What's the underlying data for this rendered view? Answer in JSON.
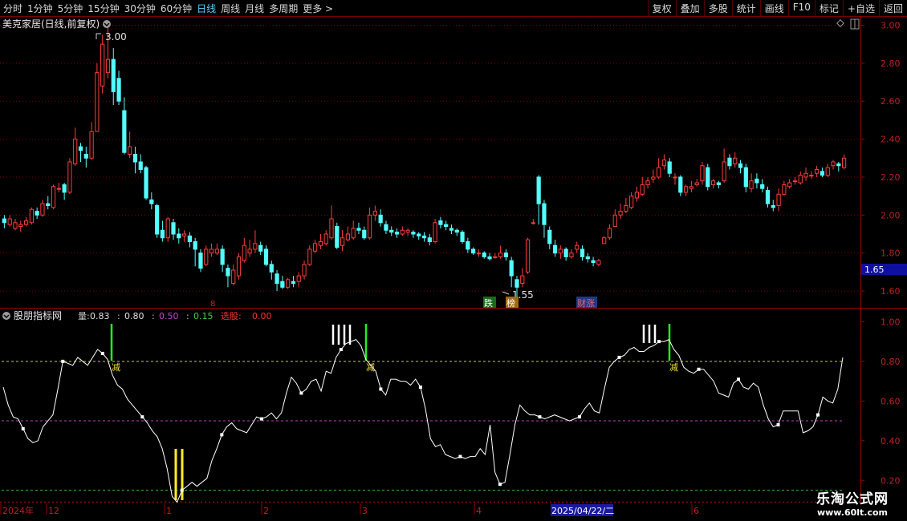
{
  "toolbar": {
    "periods": [
      "分时",
      "1分钟",
      "5分钟",
      "15分钟",
      "30分钟",
      "60分钟",
      "日线",
      "周线",
      "月线",
      "多周期",
      "更多 >"
    ],
    "active_period": "日线",
    "actions": [
      "复权",
      "叠加",
      "多股",
      "统计",
      "画线",
      "F10",
      "标记",
      "+自选",
      "返回"
    ]
  },
  "main_panel": {
    "title": "美克家居(日线,前复权)",
    "high_label": "3.00",
    "low_label": "1.55",
    "current_price_label": "1.65",
    "price_axis": [
      "3.00",
      "2.80",
      "2.60",
      "2.40",
      "2.20",
      "2.00",
      "1.80",
      "1.60"
    ],
    "price_range": [
      1.52,
      3.04
    ],
    "event_markers": [
      "跌",
      "榜",
      "财涨"
    ],
    "small_marker": "8"
  },
  "indicator_panel": {
    "name": "股朋指标网",
    "items": [
      {
        "label": "量:",
        "value": "0.83",
        "color": "#e0e0e0"
      },
      {
        "label": ":",
        "value": "0.80",
        "color": "#e0e0e0"
      },
      {
        "label": ":",
        "value": "0.50",
        "color": "#d040d0"
      },
      {
        "label": ":",
        "value": "0.15",
        "color": "#40d040"
      },
      {
        "label": "选股:",
        "value": "0.00",
        "color": "#ff3030"
      }
    ],
    "axis": [
      "1.00",
      "0.80",
      "0.60",
      "0.40",
      "0.20"
    ],
    "range": [
      0.1,
      1.05
    ],
    "level_lines": [
      {
        "value": 0.8,
        "color": "#d0d040"
      },
      {
        "value": 0.5,
        "color": "#c040c0"
      },
      {
        "value": 0.15,
        "color": "#40c040"
      }
    ],
    "reduce_label": "减"
  },
  "date_axis": {
    "labels": [
      "2024年",
      "12",
      "1",
      "2",
      "3",
      "4",
      "2025/04/22/二",
      "6"
    ]
  },
  "watermark": {
    "line1": "乐淘公式网",
    "line2": "www.60lt.com"
  },
  "chart_data": {
    "type": "candlestick",
    "title": "美克家居(日线,前复权)",
    "candles": [
      [
        1.98,
        1.96,
        2.0,
        1.93
      ],
      [
        1.95,
        1.98,
        2.0,
        1.94
      ],
      [
        1.93,
        1.96,
        1.98,
        1.92
      ],
      [
        1.94,
        1.95,
        1.97,
        1.91
      ],
      [
        1.95,
        1.97,
        1.99,
        1.94
      ],
      [
        1.96,
        2.03,
        2.04,
        1.95
      ],
      [
        2.02,
        2.0,
        2.04,
        1.98
      ],
      [
        2.0,
        2.06,
        2.08,
        1.99
      ],
      [
        2.06,
        2.05,
        2.1,
        2.03
      ],
      [
        2.04,
        2.15,
        2.16,
        2.03
      ],
      [
        2.14,
        2.14,
        2.17,
        2.12
      ],
      [
        2.16,
        2.12,
        2.17,
        2.08
      ],
      [
        2.12,
        2.28,
        2.3,
        2.11
      ],
      [
        2.27,
        2.4,
        2.46,
        2.26
      ],
      [
        2.36,
        2.34,
        2.38,
        2.28
      ],
      [
        2.32,
        2.3,
        2.36,
        2.25
      ],
      [
        2.3,
        2.44,
        2.49,
        2.29
      ],
      [
        2.44,
        2.75,
        2.8,
        2.52
      ],
      [
        2.68,
        2.9,
        2.95,
        2.64
      ],
      [
        2.75,
        2.82,
        3.0,
        2.72
      ],
      [
        2.82,
        2.65,
        2.88,
        2.58
      ],
      [
        2.72,
        2.6,
        2.76,
        2.58
      ],
      [
        2.55,
        2.33,
        2.62,
        2.32
      ],
      [
        2.32,
        2.36,
        2.44,
        2.3
      ],
      [
        2.32,
        2.28,
        2.36,
        2.22
      ],
      [
        2.28,
        2.24,
        2.32,
        2.22
      ],
      [
        2.25,
        2.09,
        2.26,
        2.08
      ],
      [
        2.08,
        2.06,
        2.12,
        2.03
      ],
      [
        2.05,
        1.9,
        2.06,
        1.88
      ],
      [
        1.92,
        1.88,
        1.97,
        1.86
      ],
      [
        1.88,
        1.98,
        1.99,
        1.86
      ],
      [
        1.96,
        1.9,
        1.98,
        1.87
      ],
      [
        1.9,
        1.88,
        1.93,
        1.85
      ],
      [
        1.89,
        1.9,
        1.92,
        1.86
      ],
      [
        1.89,
        1.86,
        1.91,
        1.83
      ],
      [
        1.86,
        1.82,
        1.88,
        1.73
      ],
      [
        1.8,
        1.72,
        1.82,
        1.7
      ],
      [
        1.74,
        1.82,
        1.84,
        1.73
      ],
      [
        1.8,
        1.82,
        1.85,
        1.78
      ],
      [
        1.8,
        1.82,
        1.85,
        1.79
      ],
      [
        1.82,
        1.74,
        1.84,
        1.7
      ],
      [
        1.72,
        1.68,
        1.74,
        1.62
      ],
      [
        1.64,
        1.71,
        1.74,
        1.63
      ],
      [
        1.68,
        1.78,
        1.8,
        1.66
      ],
      [
        1.76,
        1.84,
        1.88,
        1.75
      ],
      [
        1.8,
        1.82,
        1.87,
        1.78
      ],
      [
        1.82,
        1.85,
        1.92,
        1.8
      ],
      [
        1.84,
        1.81,
        1.86,
        1.79
      ],
      [
        1.82,
        1.74,
        1.84,
        1.73
      ],
      [
        1.74,
        1.7,
        1.76,
        1.66
      ],
      [
        1.69,
        1.64,
        1.71,
        1.6
      ],
      [
        1.65,
        1.62,
        1.68,
        1.61
      ],
      [
        1.62,
        1.66,
        1.67,
        1.61
      ],
      [
        1.65,
        1.64,
        1.68,
        1.62
      ],
      [
        1.65,
        1.68,
        1.7,
        1.62
      ],
      [
        1.68,
        1.74,
        1.76,
        1.66
      ],
      [
        1.74,
        1.82,
        1.84,
        1.73
      ],
      [
        1.81,
        1.85,
        1.87,
        1.8
      ],
      [
        1.84,
        1.86,
        1.9,
        1.82
      ],
      [
        1.85,
        1.9,
        1.92,
        1.84
      ],
      [
        1.88,
        1.98,
        2.05,
        1.87
      ],
      [
        1.94,
        1.83,
        1.96,
        1.82
      ],
      [
        1.84,
        1.88,
        1.92,
        1.81
      ],
      [
        1.87,
        1.9,
        1.94,
        1.86
      ],
      [
        1.88,
        1.93,
        1.97,
        1.87
      ],
      [
        1.93,
        1.92,
        1.96,
        1.9
      ],
      [
        1.92,
        1.88,
        1.94,
        1.87
      ],
      [
        1.88,
        2.0,
        2.04,
        1.87
      ],
      [
        2.0,
        2.02,
        2.05,
        1.97
      ],
      [
        2.0,
        1.96,
        2.03,
        1.94
      ],
      [
        1.95,
        1.92,
        1.97,
        1.9
      ],
      [
        1.92,
        1.91,
        1.94,
        1.89
      ],
      [
        1.91,
        1.9,
        1.93,
        1.88
      ],
      [
        1.9,
        1.92,
        1.94,
        1.89
      ],
      [
        1.91,
        1.92,
        1.93,
        1.89
      ],
      [
        1.91,
        1.9,
        1.92,
        1.88
      ],
      [
        1.9,
        1.89,
        1.91,
        1.87
      ],
      [
        1.89,
        1.88,
        1.91,
        1.86
      ],
      [
        1.88,
        1.86,
        1.9,
        1.84
      ],
      [
        1.86,
        1.96,
        1.98,
        1.85
      ],
      [
        1.97,
        1.95,
        1.99,
        1.93
      ],
      [
        1.95,
        1.94,
        1.97,
        1.92
      ],
      [
        1.93,
        1.92,
        1.95,
        1.9
      ],
      [
        1.92,
        1.91,
        1.93,
        1.89
      ],
      [
        1.91,
        1.86,
        1.92,
        1.85
      ],
      [
        1.86,
        1.82,
        1.88,
        1.8
      ],
      [
        1.82,
        1.8,
        1.83,
        1.79
      ],
      [
        1.8,
        1.8,
        1.82,
        1.78
      ],
      [
        1.8,
        1.78,
        1.81,
        1.77
      ],
      [
        1.78,
        1.77,
        1.8,
        1.76
      ],
      [
        1.78,
        1.78,
        1.8,
        1.77
      ],
      [
        1.78,
        1.8,
        1.84,
        1.77
      ],
      [
        1.8,
        1.78,
        1.82,
        1.76
      ],
      [
        1.76,
        1.68,
        1.78,
        1.62
      ],
      [
        1.66,
        1.62,
        1.68,
        1.55
      ],
      [
        1.64,
        1.68,
        1.72,
        1.62
      ],
      [
        1.7,
        1.87,
        1.88,
        1.69
      ],
      [
        1.96,
        1.96,
        1.98,
        1.95
      ],
      [
        2.2,
        2.06,
        2.21,
        1.95
      ],
      [
        2.06,
        1.95,
        2.08,
        1.88
      ],
      [
        1.92,
        1.85,
        1.94,
        1.82
      ],
      [
        1.84,
        1.8,
        1.87,
        1.78
      ],
      [
        1.8,
        1.82,
        1.84,
        1.77
      ],
      [
        1.82,
        1.78,
        1.83,
        1.76
      ],
      [
        1.78,
        1.8,
        1.82,
        1.77
      ],
      [
        1.82,
        1.84,
        1.86,
        1.8
      ],
      [
        1.82,
        1.78,
        1.84,
        1.76
      ],
      [
        1.78,
        1.77,
        1.8,
        1.75
      ],
      [
        1.76,
        1.75,
        1.78,
        1.73
      ],
      [
        1.74,
        1.76,
        1.77,
        1.73
      ],
      [
        1.85,
        1.88,
        1.89,
        1.85
      ],
      [
        1.88,
        1.93,
        1.95,
        1.87
      ],
      [
        1.94,
        2.0,
        2.03,
        1.94
      ],
      [
        2.0,
        2.02,
        2.06,
        1.98
      ],
      [
        2.02,
        2.05,
        2.09,
        2.01
      ],
      [
        2.04,
        2.1,
        2.12,
        2.03
      ],
      [
        2.09,
        2.12,
        2.15,
        2.07
      ],
      [
        2.11,
        2.16,
        2.2,
        2.1
      ],
      [
        2.16,
        2.18,
        2.2,
        2.14
      ],
      [
        2.19,
        2.2,
        2.24,
        2.17
      ],
      [
        2.2,
        2.25,
        2.3,
        2.19
      ],
      [
        2.26,
        2.29,
        2.32,
        2.24
      ],
      [
        2.28,
        2.22,
        2.3,
        2.2
      ],
      [
        2.2,
        2.2,
        2.22,
        2.16
      ],
      [
        2.2,
        2.12,
        2.21,
        2.1
      ],
      [
        2.12,
        2.15,
        2.16,
        2.1
      ],
      [
        2.14,
        2.15,
        2.18,
        2.12
      ],
      [
        2.16,
        2.17,
        2.19,
        2.15
      ],
      [
        2.18,
        2.26,
        2.28,
        2.16
      ],
      [
        2.25,
        2.15,
        2.27,
        2.13
      ],
      [
        2.16,
        2.18,
        2.19,
        2.14
      ],
      [
        2.17,
        2.16,
        2.18,
        2.14
      ],
      [
        2.18,
        2.28,
        2.35,
        2.17
      ],
      [
        2.3,
        2.26,
        2.32,
        2.24
      ],
      [
        2.27,
        2.3,
        2.33,
        2.25
      ],
      [
        2.27,
        2.25,
        2.29,
        2.22
      ],
      [
        2.25,
        2.15,
        2.27,
        2.12
      ],
      [
        2.14,
        2.18,
        2.22,
        2.12
      ],
      [
        2.19,
        2.17,
        2.22,
        2.14
      ],
      [
        2.16,
        2.14,
        2.19,
        2.12
      ],
      [
        2.13,
        2.06,
        2.15,
        2.04
      ],
      [
        2.05,
        2.04,
        2.08,
        2.02
      ],
      [
        2.05,
        2.11,
        2.14,
        2.02
      ],
      [
        2.11,
        2.16,
        2.18,
        2.1
      ],
      [
        2.15,
        2.17,
        2.19,
        2.14
      ],
      [
        2.18,
        2.18,
        2.2,
        2.16
      ],
      [
        2.17,
        2.21,
        2.23,
        2.16
      ],
      [
        2.2,
        2.22,
        2.25,
        2.18
      ],
      [
        2.21,
        2.21,
        2.23,
        2.19
      ],
      [
        2.22,
        2.24,
        2.26,
        2.2
      ],
      [
        2.23,
        2.21,
        2.25,
        2.2
      ],
      [
        2.21,
        2.25,
        2.27,
        2.2
      ],
      [
        2.26,
        2.28,
        2.29,
        2.24
      ],
      [
        2.27,
        2.26,
        2.28,
        2.23
      ],
      [
        2.25,
        2.3,
        2.32,
        2.24
      ]
    ],
    "indicator_line": [
      0.67,
      0.58,
      0.52,
      0.51,
      0.46,
      0.41,
      0.39,
      0.4,
      0.47,
      0.5,
      0.53,
      0.66,
      0.8,
      0.79,
      0.78,
      0.82,
      0.8,
      0.78,
      0.82,
      0.86,
      0.84,
      0.81,
      0.73,
      0.68,
      0.66,
      0.61,
      0.58,
      0.55,
      0.52,
      0.49,
      0.45,
      0.42,
      0.36,
      0.26,
      0.12,
      0.09,
      0.15,
      0.17,
      0.19,
      0.17,
      0.19,
      0.21,
      0.3,
      0.36,
      0.43,
      0.47,
      0.49,
      0.46,
      0.45,
      0.44,
      0.48,
      0.52,
      0.51,
      0.52,
      0.54,
      0.51,
      0.54,
      0.64,
      0.72,
      0.69,
      0.64,
      0.66,
      0.7,
      0.71,
      0.65,
      0.75,
      0.74,
      0.82,
      0.86,
      0.89,
      0.9,
      0.91,
      0.88,
      0.81,
      0.78,
      0.75,
      0.66,
      0.63,
      0.71,
      0.71,
      0.7,
      0.7,
      0.68,
      0.71,
      0.67,
      0.56,
      0.41,
      0.37,
      0.38,
      0.33,
      0.32,
      0.31,
      0.32,
      0.31,
      0.32,
      0.32,
      0.36,
      0.33,
      0.48,
      0.24,
      0.18,
      0.19,
      0.33,
      0.48,
      0.58,
      0.55,
      0.53,
      0.53,
      0.52,
      0.51,
      0.52,
      0.53,
      0.52,
      0.51,
      0.5,
      0.51,
      0.52,
      0.56,
      0.59,
      0.55,
      0.54,
      0.66,
      0.77,
      0.8,
      0.82,
      0.83,
      0.86,
      0.87,
      0.85,
      0.85,
      0.87,
      0.88,
      0.9,
      0.9,
      0.91,
      0.86,
      0.83,
      0.77,
      0.75,
      0.74,
      0.76,
      0.76,
      0.73,
      0.7,
      0.64,
      0.63,
      0.62,
      0.69,
      0.71,
      0.67,
      0.66,
      0.69,
      0.67,
      0.58,
      0.51,
      0.47,
      0.48,
      0.55,
      0.55,
      0.55,
      0.55,
      0.44,
      0.45,
      0.47,
      0.53,
      0.62,
      0.6,
      0.59,
      0.66,
      0.82
    ]
  }
}
